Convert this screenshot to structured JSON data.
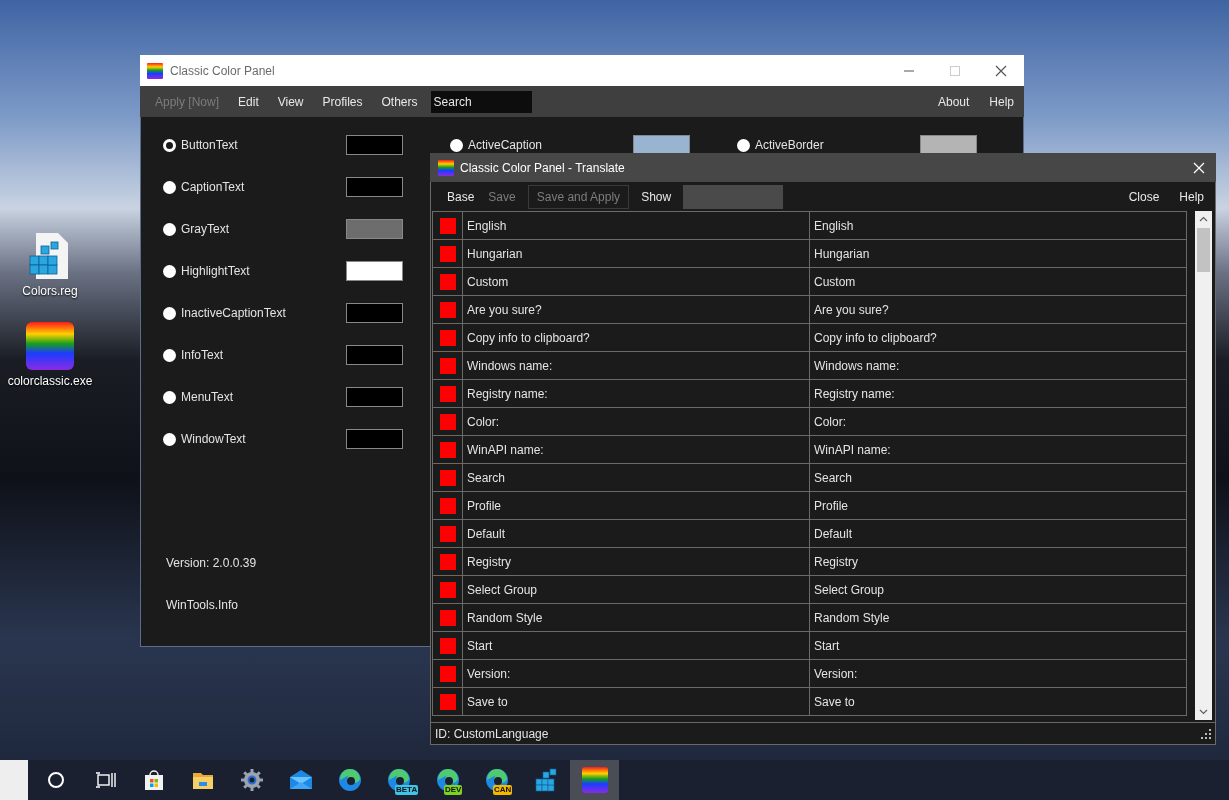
{
  "desktop_icons": [
    {
      "kind": "registry",
      "label": "Colors.reg"
    },
    {
      "kind": "rainbow",
      "label": "colorclassic.exe"
    }
  ],
  "main_window": {
    "title": "Classic Color Panel",
    "menu": [
      {
        "label": "Apply [Now]",
        "disabled": true
      },
      {
        "label": "Edit",
        "disabled": false
      },
      {
        "label": "View",
        "disabled": false
      },
      {
        "label": "Profiles",
        "disabled": false
      },
      {
        "label": "Others",
        "disabled": false
      }
    ],
    "search": {
      "placeholder": "Search"
    },
    "menu_right": [
      "About",
      "Help"
    ],
    "color_items": [
      {
        "label": "ButtonText",
        "selected": true,
        "color": "#000000"
      },
      {
        "label": "CaptionText",
        "selected": false,
        "color": "#000000"
      },
      {
        "label": "GrayText",
        "selected": false,
        "color": "#6d6d6d"
      },
      {
        "label": "HighlightText",
        "selected": false,
        "color": "#ffffff"
      },
      {
        "label": "InactiveCaptionText",
        "selected": false,
        "color": "#000000"
      },
      {
        "label": "InfoText",
        "selected": false,
        "color": "#000000"
      },
      {
        "label": "MenuText",
        "selected": false,
        "color": "#000000"
      },
      {
        "label": "WindowText",
        "selected": false,
        "color": "#000000"
      }
    ],
    "other_color_items": [
      {
        "label": "ActiveCaption",
        "selected": false,
        "color": "#99b4d1"
      },
      {
        "label": "ActiveBorder",
        "selected": false,
        "color": "#b4b4b4"
      }
    ],
    "version": "Version: 2.0.0.39",
    "website": "WinTools.Info"
  },
  "translate_window": {
    "title": "Classic Color Panel - Translate",
    "menu": [
      {
        "kind": "item",
        "label": "Base",
        "disabled": false
      },
      {
        "kind": "item",
        "label": "Save",
        "disabled": true
      },
      {
        "kind": "button",
        "label": "Save and Apply",
        "disabled": true
      },
      {
        "kind": "item",
        "label": "Show",
        "disabled": false
      }
    ],
    "menu_right": [
      "Close",
      "Help"
    ],
    "rows": [
      {
        "source": "English",
        "translation": "English"
      },
      {
        "source": "Hungarian",
        "translation": "Hungarian"
      },
      {
        "source": "Custom",
        "translation": "Custom"
      },
      {
        "source": "Are you sure?",
        "translation": "Are you sure?"
      },
      {
        "source": "Copy info to clipboard?",
        "translation": "Copy info to clipboard?"
      },
      {
        "source": "Windows name:",
        "translation": "Windows name:"
      },
      {
        "source": "Registry name:",
        "translation": "Registry name:"
      },
      {
        "source": "Color:",
        "translation": "Color:"
      },
      {
        "source": "WinAPI name:",
        "translation": "WinAPI name:"
      },
      {
        "source": "Search",
        "translation": "Search"
      },
      {
        "source": "Profile",
        "translation": "Profile"
      },
      {
        "source": "Default",
        "translation": "Default"
      },
      {
        "source": "Registry",
        "translation": "Registry"
      },
      {
        "source": "Select Group",
        "translation": "Select Group"
      },
      {
        "source": "Random Style",
        "translation": "Random Style"
      },
      {
        "source": "Start",
        "translation": "Start"
      },
      {
        "source": "Version:",
        "translation": "Version:"
      },
      {
        "source": "Save to",
        "translation": "Save to"
      }
    ],
    "status": "ID: CustomLanguage"
  },
  "taskbar": {
    "items": [
      {
        "kind": "search",
        "selected": false
      },
      {
        "kind": "taskview",
        "selected": false
      },
      {
        "kind": "store",
        "selected": false
      },
      {
        "kind": "folder",
        "selected": false
      },
      {
        "kind": "gear",
        "selected": false
      },
      {
        "kind": "mail",
        "selected": false
      },
      {
        "kind": "edge",
        "selected": false
      },
      {
        "kind": "edge",
        "badge": "BETA",
        "color": "#3fc3e6",
        "selected": false
      },
      {
        "kind": "edge",
        "badge": "DEV",
        "color": "#7ed321",
        "selected": false
      },
      {
        "kind": "edge",
        "badge": "CAN",
        "color": "#f5b800",
        "selected": false
      },
      {
        "kind": "registry",
        "selected": false
      },
      {
        "kind": "rainbow",
        "selected": true
      }
    ]
  }
}
